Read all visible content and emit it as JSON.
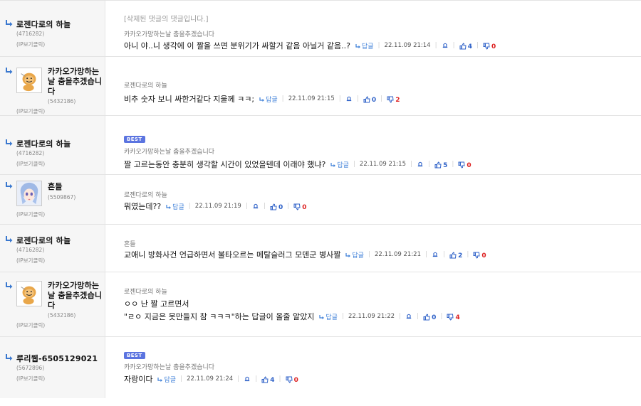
{
  "reply_label": "답글",
  "comments": [
    {
      "nickname": "로젠다로의 하늘",
      "user_id": "(4716282)",
      "ip": "(IP보기클릭)",
      "deleted_notice": "[삭제된 댓글의 댓글입니다.]",
      "parent": "카카오가망하는날 춤을추겠습니다",
      "best": "",
      "text": "아니 야..니 생각에 이 짤을 쓰면 분위기가 싸할거 같음 아닐거 같음..?",
      "date": "22.11.09 21:14",
      "up": "4",
      "down": "0"
    },
    {
      "nickname": "카카오가망하는날 춤을추겠습니다",
      "user_id": "(5432186)",
      "ip": "(IP보기클릭)",
      "parent": "로젠다로의 하늘",
      "text": "비추 숫자 보니 싸한거같다 지울께 ㅋㅋ;",
      "date": "22.11.09 21:15",
      "up": "0",
      "down": "2"
    },
    {
      "nickname": "로젠다로의 하늘",
      "user_id": "(4716282)",
      "ip": "(IP보기클릭)",
      "best": "BEST",
      "parent": "카카오가망하는날 춤을추겠습니다",
      "text": "짤 고르는동안 충분히 생각할 시간이 있었을텐데 이래야 했냐?",
      "date": "22.11.09 21:15",
      "up": "5",
      "down": "0"
    },
    {
      "nickname": "흔들",
      "user_id": "(5509867)",
      "ip": "(IP보기클릭)",
      "parent": "로젠다로의 하늘",
      "text": "뭐였는데??",
      "date": "22.11.09 21:19",
      "up": "0",
      "down": "0"
    },
    {
      "nickname": "로젠다로의 하늘",
      "user_id": "(4716282)",
      "ip": "(IP보기클릭)",
      "parent": "흔들",
      "text": "교애니 방화사건 언급하면서 불타오르는 메탈슬러그 모덴군 병사짤",
      "date": "22.11.09 21:21",
      "up": "2",
      "down": "0"
    },
    {
      "nickname": "카카오가망하는날 춤을추겠습니다",
      "user_id": "(5432186)",
      "ip": "(IP보기클릭)",
      "parent": "로젠다로의 하늘",
      "text_line1": "ㅇㅇ 난 짤 고르면서",
      "text": "\"ㄹㅇ 지금은 못만들지 참 ㅋㅋㅋ\"하는 답글이 올줄 알았지",
      "date": "22.11.09 21:22",
      "up": "0",
      "down": "4"
    },
    {
      "nickname": "루리웹-6505129021",
      "user_id": "(5672896)",
      "ip": "(IP보기클릭)",
      "best": "BEST",
      "parent": "카카오가망하는날 춤을추겠습니다",
      "text": "자랑이다",
      "date": "22.11.09 21:24",
      "up": "4",
      "down": "0"
    }
  ],
  "icons": {
    "reply_arrow": "reply-arrow-icon",
    "report": "bell-icon",
    "upvote": "thumbs-up-icon",
    "downvote": "thumbs-down-icon",
    "avatar_lion": "lion-avatar",
    "avatar_anime": "anime-girl-avatar"
  },
  "colors": {
    "upvote": "#2f62c8",
    "downvote": "#dd2222",
    "reply": "#3d7fd8",
    "best_badge": "#5b74e0"
  }
}
